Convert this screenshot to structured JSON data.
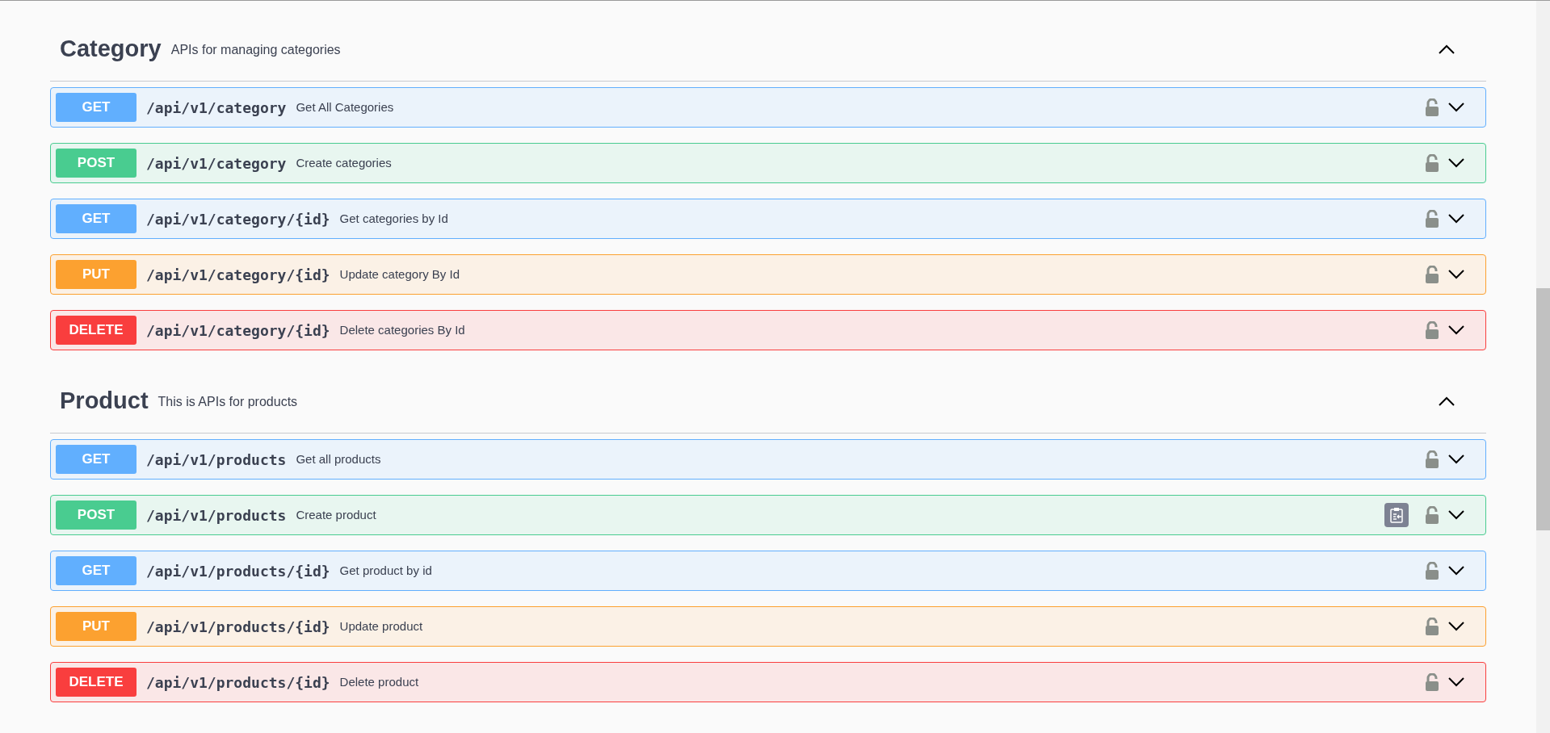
{
  "sections": [
    {
      "title": "Category",
      "description": "APIs for managing categories",
      "expanded": true,
      "operations": [
        {
          "method": "GET",
          "kind": "get",
          "path": "/api/v1/category",
          "summary": "Get All Categories",
          "copy_button": false
        },
        {
          "method": "POST",
          "kind": "post",
          "path": "/api/v1/category",
          "summary": "Create categories",
          "copy_button": false
        },
        {
          "method": "GET",
          "kind": "get",
          "path": "/api/v1/category/{id}",
          "summary": "Get categories by Id",
          "copy_button": false
        },
        {
          "method": "PUT",
          "kind": "put",
          "path": "/api/v1/category/{id}",
          "summary": "Update category By Id",
          "copy_button": false
        },
        {
          "method": "DELETE",
          "kind": "delete",
          "path": "/api/v1/category/{id}",
          "summary": "Delete categories By Id",
          "copy_button": false
        }
      ]
    },
    {
      "title": "Product",
      "description": "This is APIs for products",
      "expanded": true,
      "operations": [
        {
          "method": "GET",
          "kind": "get",
          "path": "/api/v1/products",
          "summary": "Get all products",
          "copy_button": false
        },
        {
          "method": "POST",
          "kind": "post",
          "path": "/api/v1/products",
          "summary": "Create product",
          "copy_button": true
        },
        {
          "method": "GET",
          "kind": "get",
          "path": "/api/v1/products/{id}",
          "summary": "Get product by id",
          "copy_button": false
        },
        {
          "method": "PUT",
          "kind": "put",
          "path": "/api/v1/products/{id}",
          "summary": "Update product",
          "copy_button": false
        },
        {
          "method": "DELETE",
          "kind": "delete",
          "path": "/api/v1/products/{id}",
          "summary": "Delete product",
          "copy_button": false
        }
      ]
    }
  ]
}
